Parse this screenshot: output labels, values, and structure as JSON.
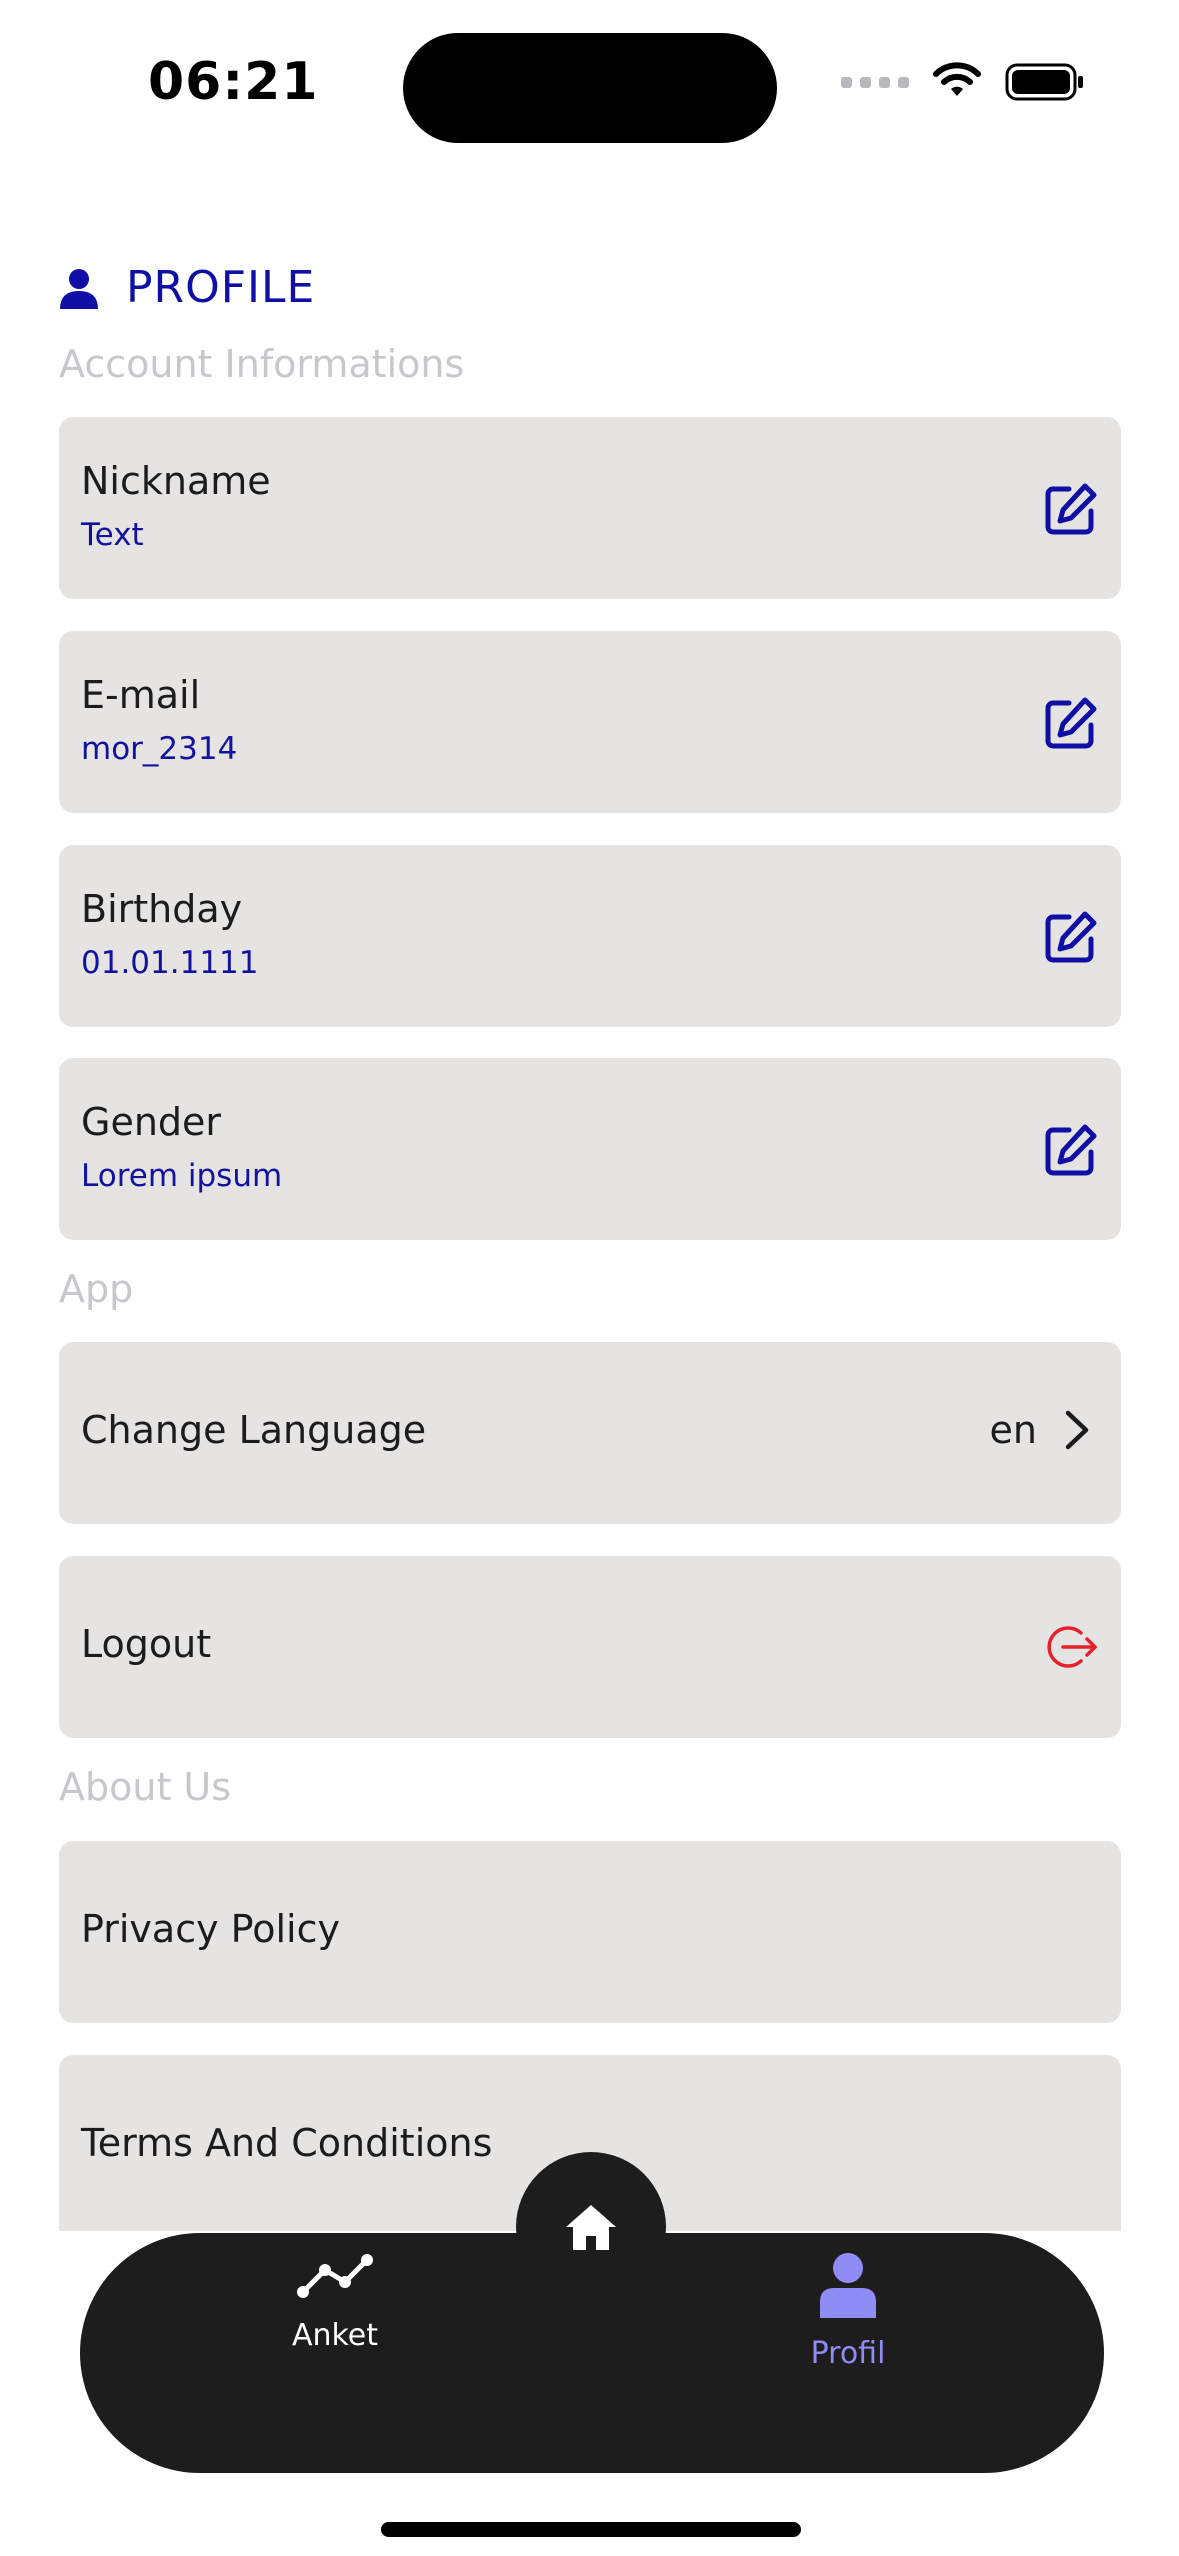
{
  "status_bar": {
    "time": "06:21"
  },
  "header": {
    "title": "PROFILE"
  },
  "sections": {
    "account": "Account Informations",
    "app": "App",
    "about": "About Us"
  },
  "account_fields": [
    {
      "label": "Nickname",
      "value": "Text"
    },
    {
      "label": "E-mail",
      "value": "mor_2314"
    },
    {
      "label": "Birthday",
      "value": "01.01.1111"
    },
    {
      "label": "Gender",
      "value": "Lorem ipsum"
    }
  ],
  "app_items": {
    "change_language": {
      "label": "Change Language",
      "value": "en"
    },
    "logout": {
      "label": "Logout"
    }
  },
  "about_items": {
    "privacy": "Privacy Policy",
    "terms": "Terms And Conditions"
  },
  "tabbar": {
    "tabs": [
      {
        "label": "Anket",
        "icon": "chart-line-icon",
        "active": false
      },
      {
        "label": "Home",
        "icon": "home-icon",
        "active": false
      },
      {
        "label": "Profil",
        "icon": "user-icon",
        "active": true
      }
    ]
  },
  "colors": {
    "accent": "#0f0fa6",
    "active_tab": "#8f8cf5",
    "logout": "#e8202a",
    "card": "#e5e4e3",
    "tabbar": "#1d1d1d"
  }
}
